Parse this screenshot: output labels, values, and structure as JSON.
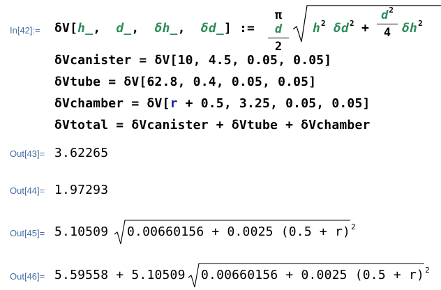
{
  "labels": {
    "in42": "In[42]:=",
    "out43": "Out[43]=",
    "out44": "Out[44]=",
    "out45": "Out[45]=",
    "out46": "Out[46]="
  },
  "def": {
    "lhs_head": "δV[",
    "arg_h": "h_",
    "arg_d": "d_",
    "arg_dh": "δh_",
    "arg_dd": "δd_",
    "sep": ",",
    "close": "]",
    "assign": ":=",
    "frac1_num_pi": "π",
    "frac1_num_d": "d",
    "frac1_den": "2",
    "rad_h": "h",
    "exp2": "2",
    "rad_dd": "δd",
    "plus": "+",
    "frac2_num": "d",
    "frac2_den": "4",
    "rad_dh": "δh"
  },
  "inputs": {
    "canister": "δVcanister = δV[10, 4.5, 0.05, 0.05]",
    "tube": "δVtube = δV[62.8, 0.4, 0.05, 0.05]",
    "chamber_pre": "δVchamber = δV[",
    "chamber_r": "r",
    "chamber_post": " + 0.5, 3.25, 0.05, 0.05]",
    "total": "δVtotal = δVcanister + δVtube + δVchamber"
  },
  "outputs": {
    "out43": "3.62265",
    "out44": "1.97293",
    "out45_coef": "5.10509",
    "out45_rad": "0.00660156 + 0.0025 (0.5 + r)",
    "out45_exp": "2",
    "out46_pre": "5.59558 + 5.10509",
    "out46_rad": "0.00660156 + 0.0025 (0.5 + r)",
    "out46_exp": "2"
  }
}
